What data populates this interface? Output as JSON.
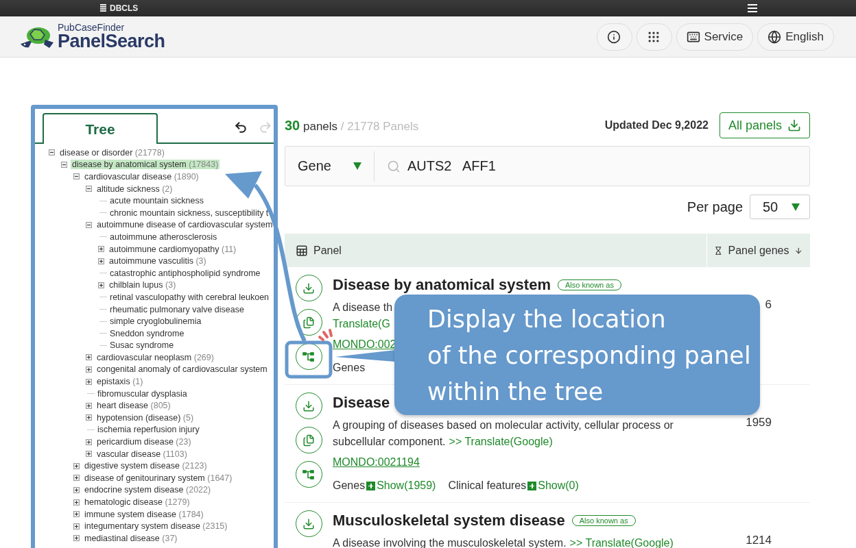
{
  "top_bar": {
    "brand": "DBCLS"
  },
  "header": {
    "logo_small": "PubCaseFinder",
    "logo_large": "PanelSearch",
    "buttons": [
      {
        "kind": "info"
      },
      {
        "kind": "apps"
      },
      {
        "kind": "service",
        "label": "Service"
      },
      {
        "kind": "language",
        "label": "English"
      }
    ]
  },
  "tree": {
    "tab": "Tree",
    "nodes": [
      {
        "label": "disease or disorder",
        "count": "(21778)",
        "expanded": true,
        "selected": false,
        "children": [
          {
            "label": "disease by anatomical system",
            "count": "(17843)",
            "expanded": true,
            "selected": true,
            "children": [
              {
                "label": "cardiovascular disease",
                "count": "(1890)",
                "expanded": true,
                "selected": false,
                "children": [
                  {
                    "label": "altitude sickness",
                    "count": "(2)",
                    "expanded": true,
                    "selected": false,
                    "children": [
                      {
                        "label": "acute mountain sickness",
                        "selected": false
                      },
                      {
                        "label": "chronic mountain sickness, susceptibility t",
                        "selected": false
                      }
                    ]
                  },
                  {
                    "label": "autoimmune disease of cardiovascular system",
                    "expanded": true,
                    "selected": false,
                    "children": [
                      {
                        "label": "autoimmune atherosclerosis",
                        "selected": false
                      },
                      {
                        "label": "autoimmune cardiomyopathy",
                        "count": "(11)",
                        "expanded": false,
                        "selected": false
                      },
                      {
                        "label": "autoimmune vasculitis",
                        "count": "(3)",
                        "expanded": false,
                        "selected": false
                      },
                      {
                        "label": "catastrophic antiphospholipid syndrome",
                        "selected": false
                      },
                      {
                        "label": "chilblain lupus",
                        "count": "(3)",
                        "expanded": false,
                        "selected": false
                      },
                      {
                        "label": "retinal vasculopathy with cerebral leukoen",
                        "selected": false
                      },
                      {
                        "label": "rheumatic pulmonary valve disease",
                        "selected": false
                      },
                      {
                        "label": "simple cryoglobulinemia",
                        "selected": false
                      },
                      {
                        "label": "Sneddon syndrome",
                        "selected": false
                      },
                      {
                        "label": "Susac syndrome",
                        "selected": false
                      }
                    ]
                  },
                  {
                    "label": "cardiovascular neoplasm",
                    "count": "(269)",
                    "expanded": false,
                    "selected": false
                  },
                  {
                    "label": "congenital anomaly of cardiovascular system",
                    "expanded": false,
                    "selected": false
                  },
                  {
                    "label": "epistaxis",
                    "count": "(1)",
                    "expanded": false,
                    "selected": false
                  },
                  {
                    "label": "fibromuscular dysplasia",
                    "selected": false
                  },
                  {
                    "label": "heart disease",
                    "count": "(805)",
                    "expanded": false,
                    "selected": false
                  },
                  {
                    "label": "hypotension (disease)",
                    "count": "(5)",
                    "expanded": false,
                    "selected": false
                  },
                  {
                    "label": "ischemia reperfusion injury",
                    "selected": false
                  },
                  {
                    "label": "pericardium disease",
                    "count": "(23)",
                    "expanded": false,
                    "selected": false
                  },
                  {
                    "label": "vascular disease",
                    "count": "(1103)",
                    "expanded": false,
                    "selected": false
                  }
                ]
              },
              {
                "label": "digestive system disease",
                "count": "(2123)",
                "expanded": false,
                "selected": false
              },
              {
                "label": "disease of genitourinary system",
                "count": "(1647)",
                "expanded": false,
                "selected": false
              },
              {
                "label": "endocrine system disease",
                "count": "(2022)",
                "expanded": false,
                "selected": false
              },
              {
                "label": "hematologic disease",
                "count": "(1279)",
                "expanded": false,
                "selected": false
              },
              {
                "label": "immune system disease",
                "count": "(1784)",
                "expanded": false,
                "selected": false
              },
              {
                "label": "integumentary system disease",
                "count": "(2315)",
                "expanded": false,
                "selected": false
              },
              {
                "label": "mediastinal disease",
                "count": "(37)",
                "expanded": false,
                "selected": false
              }
            ]
          }
        ]
      }
    ]
  },
  "summary": {
    "count": "30",
    "unit": "panels",
    "total": "/ 21778 Panels",
    "updated": "Updated Dec 9,2022",
    "all_button": "All panels"
  },
  "search": {
    "type": "Gene",
    "value": "AUTS2   AFF1"
  },
  "per_page": {
    "label": "Per page",
    "value": "50"
  },
  "table": {
    "columns": [
      {
        "kind": "panel",
        "label": "Panel"
      },
      {
        "kind": "genes",
        "label": "Panel genes",
        "sort_descending": true
      }
    ],
    "rows": [
      {
        "actions": [
          {
            "kind": "download"
          },
          {
            "kind": "copy"
          },
          {
            "kind": "tree"
          }
        ],
        "title": "Disease by anatomical system",
        "tag": "Also known as",
        "lines": [
          [
            {
              "kind": "text",
              "text": "A disease th"
            }
          ],
          [
            {
              "kind": "link",
              "text": "Translate(G"
            }
          ]
        ],
        "mondo": "MONDO:002",
        "features": [
          {
            "label": "Genes"
          }
        ],
        "count": "6"
      },
      {
        "actions": [
          {
            "kind": "download"
          },
          {
            "kind": "copy"
          },
          {
            "kind": "tree"
          }
        ],
        "title": "Disease",
        "lines": [
          [
            {
              "kind": "text",
              "text": "A grouping of diseases based on molecular activity, cellular process or"
            }
          ],
          [
            {
              "kind": "text",
              "text": "subcellular component."
            },
            {
              "kind": "link",
              "text": ">> Translate(Google)"
            }
          ]
        ],
        "mondo": "MONDO:0021194",
        "features": [
          {
            "label": "Genes",
            "show": "Show(1959)"
          },
          {
            "label": "Clinical features",
            "show": "Show(0)"
          }
        ],
        "count": "1959"
      },
      {
        "actions": [
          {
            "kind": "download"
          }
        ],
        "title": "Musculoskeletal system disease",
        "tag": "Also known as",
        "lines": [
          [
            {
              "kind": "text",
              "text": "A disease involving the musculoskeletal system."
            },
            {
              "kind": "link",
              "text": ">> Translate(Google)"
            }
          ]
        ],
        "count": "1214"
      }
    ]
  },
  "callout": {
    "lines": [
      "Display the location",
      "of the corresponding panel",
      "within the tree"
    ]
  }
}
